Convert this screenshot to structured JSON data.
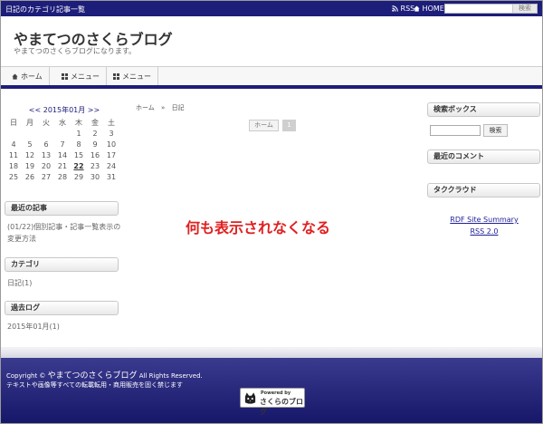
{
  "topbar": {
    "title": "日記のカテゴリ記事一覧",
    "rss": "RSS",
    "home": "HOME",
    "search_button": "検索"
  },
  "header": {
    "title": "やまてつのさくらブログ",
    "description": "やまてつのさくらブログになります。"
  },
  "nav": {
    "items": [
      "ホーム",
      "メニュー",
      "メニュー"
    ]
  },
  "calendar": {
    "title": "<< 2015年01月 >>",
    "weekdays": [
      "日",
      "月",
      "火",
      "水",
      "木",
      "金",
      "土"
    ],
    "weeks": [
      [
        "",
        "",
        "",
        "",
        "1",
        "2",
        "3"
      ],
      [
        "4",
        "5",
        "6",
        "7",
        "8",
        "9",
        "10"
      ],
      [
        "11",
        "12",
        "13",
        "14",
        "15",
        "16",
        "17"
      ],
      [
        "18",
        "19",
        "20",
        "21",
        "22",
        "23",
        "24"
      ],
      [
        "25",
        "26",
        "27",
        "28",
        "29",
        "30",
        "31"
      ]
    ],
    "today": "22"
  },
  "left": {
    "recent_heading": "最近の記事",
    "recent_line1": "(01/22)個別記事・記事一覧表示の",
    "recent_line2": "変更方法",
    "category_heading": "カテゴリ",
    "category_item": "日記(1)",
    "archive_heading": "過去ログ",
    "archive_item": "2015年01月(1)"
  },
  "center": {
    "breadcrumb_home": "ホーム",
    "breadcrumb_sep": "»",
    "breadcrumb_current": "日記",
    "pager_home": "ホーム",
    "pager_page": "1",
    "annotation": "何も表示されなくなる"
  },
  "right": {
    "search_heading": "検索ボックス",
    "search_button": "検索",
    "comments_heading": "最近のコメント",
    "tagcloud_heading": "タククラウド",
    "rdf_link": "RDF Site Summary",
    "rss_link": "RSS 2.0"
  },
  "footer": {
    "copyright_prefix": "Copyright ©",
    "copyright_name": "やまてつのさくらブログ",
    "copyright_suffix": "All Rights Reserved.",
    "notice": "テキストや画像等すべての転載転用・商用販売を固く禁じます",
    "badge_powered": "Powered by",
    "badge_name": "さくらのブログ"
  },
  "colors": {
    "accent": "#1d1d7a",
    "annotation": "#e02020",
    "link": "#1d1d9a"
  }
}
